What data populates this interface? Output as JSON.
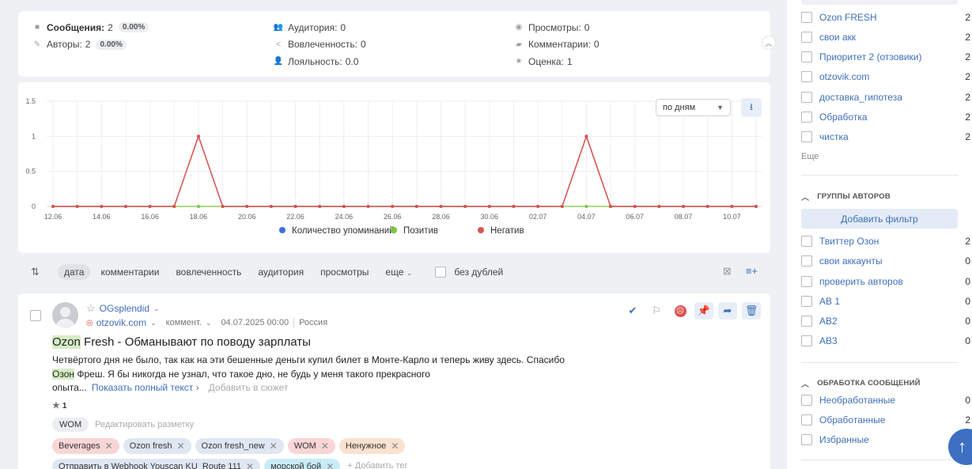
{
  "stats": {
    "messages_label": "Сообщения:",
    "messages_value": "2",
    "messages_pct": "0.00%",
    "authors_label": "Авторы:",
    "authors_value": "2",
    "authors_pct": "0.00%",
    "audience_label": "Аудитория:",
    "audience_value": "0",
    "engagement_label": "Вовлеченность:",
    "engagement_value": "0",
    "loyalty_label": "Лояльность:",
    "loyalty_value": "0.0",
    "views_label": "Просмотры:",
    "views_value": "0",
    "comments_label": "Комментарии:",
    "comments_value": "0",
    "rating_label": "Оценка:",
    "rating_value": "1"
  },
  "chart_controls": {
    "period": "по дням"
  },
  "chart_data": {
    "type": "line",
    "x": [
      "12.06",
      "13.06",
      "14.06",
      "15.06",
      "16.06",
      "17.06",
      "18.06",
      "19.06",
      "20.06",
      "21.06",
      "22.06",
      "23.06",
      "24.06",
      "25.06",
      "26.06",
      "27.06",
      "28.06",
      "29.06",
      "30.06",
      "01.07",
      "02.07",
      "03.07",
      "04.07",
      "05.07",
      "06.07",
      "07.07",
      "08.07",
      "09.07",
      "10.07",
      "11.07"
    ],
    "x_tick_labels": [
      "12.06",
      "14.06",
      "16.06",
      "18.06",
      "20.06",
      "22.06",
      "24.06",
      "26.06",
      "28.06",
      "30.06",
      "02.07",
      "04.07",
      "06.07",
      "08.07",
      "10.07"
    ],
    "y_tick_labels": [
      "0",
      "0.5",
      "1",
      "1.5"
    ],
    "ylim": [
      0,
      1.5
    ],
    "series": [
      {
        "name": "Количество упоминаний",
        "color": "#3a6fd8",
        "values": [
          0,
          0,
          0,
          0,
          0,
          0,
          1,
          0,
          0,
          0,
          0,
          0,
          0,
          0,
          0,
          0,
          0,
          0,
          0,
          0,
          0,
          0,
          1,
          0,
          0,
          0,
          0,
          0,
          0,
          0
        ]
      },
      {
        "name": "Позитив",
        "color": "#7cc444",
        "values": [
          0,
          0,
          0,
          0,
          0,
          0,
          0,
          0,
          0,
          0,
          0,
          0,
          0,
          0,
          0,
          0,
          0,
          0,
          0,
          0,
          0,
          0,
          0,
          0,
          0,
          0,
          0,
          0,
          0,
          0
        ]
      },
      {
        "name": "Негатив",
        "color": "#d9534f",
        "values": [
          0,
          0,
          0,
          0,
          0,
          0,
          1,
          0,
          0,
          0,
          0,
          0,
          0,
          0,
          0,
          0,
          0,
          0,
          0,
          0,
          0,
          0,
          1,
          0,
          0,
          0,
          0,
          0,
          0,
          0
        ]
      }
    ],
    "grid": true,
    "legend_position": "bottom"
  },
  "sort": {
    "items": [
      "дата",
      "комментарии",
      "вовлеченность",
      "аудитория",
      "просмотры",
      "еще"
    ],
    "no_dupes": "без дублей"
  },
  "post": {
    "author": "OGsplendid",
    "source": "otzovik.com",
    "type": "коммент.",
    "datetime": "04.07.2025 00:00",
    "country": "Россия",
    "title_hl": "Ozon",
    "title_rest": " Fresh - Обманывают по поводу зарплаты",
    "body_line1": "Четвёртого дня не было, так как на эти бешенные деньги купил билет в Монте-Карло и теперь живу здесь. Спасибо",
    "body_hl": "Озон",
    "body_line2": " Фреш. Я бы никогда не узнал, что такое дно, не будь у меня такого прекрасного",
    "body_line3": "опыта...",
    "show_full": "Показать полный текст",
    "add_story": "Добавить в сюжет",
    "rating": "1",
    "wom": "WOM",
    "edit_markup": "Редактировать разметку",
    "tags_row1": [
      "Beverages",
      "Ozon fresh",
      "Ozon fresh_new",
      "WOM",
      "Ненужное"
    ],
    "tags_row2": [
      "Отправить в Webhook Youscan KU_Route 111",
      "морской бой"
    ],
    "add_tag": "Добавить тег"
  },
  "sidebar": {
    "tags": [
      {
        "label": "Ozon FRESH",
        "count": "2"
      },
      {
        "label": "свои акк",
        "count": "2"
      },
      {
        "label": "Приоритет 2 (отзовики)",
        "count": "2"
      },
      {
        "label": "otzovik.com",
        "count": "2"
      },
      {
        "label": "доставка_гипотеза",
        "count": "2"
      },
      {
        "label": "Обработка",
        "count": "2"
      },
      {
        "label": "чистка",
        "count": "2"
      }
    ],
    "more": "Еще",
    "author_groups_title": "ГРУППЫ АВТОРОВ",
    "add_filter": "Добавить фильтр",
    "author_groups": [
      {
        "label": "Твиттер Озон",
        "count": "2"
      },
      {
        "label": "свои аккаунты",
        "count": "0"
      },
      {
        "label": "проверить авторов",
        "count": "0"
      },
      {
        "label": "AB 1",
        "count": "0"
      },
      {
        "label": "AB2",
        "count": "0"
      },
      {
        "label": "AB3",
        "count": "0"
      }
    ],
    "processing_title": "ОБРАБОТКА СООБЩЕНИЙ",
    "processing": [
      {
        "label": "Необработанные",
        "count": "0"
      },
      {
        "label": "Обработанные",
        "count": "2"
      },
      {
        "label": "Избранные",
        "count": ""
      }
    ]
  }
}
